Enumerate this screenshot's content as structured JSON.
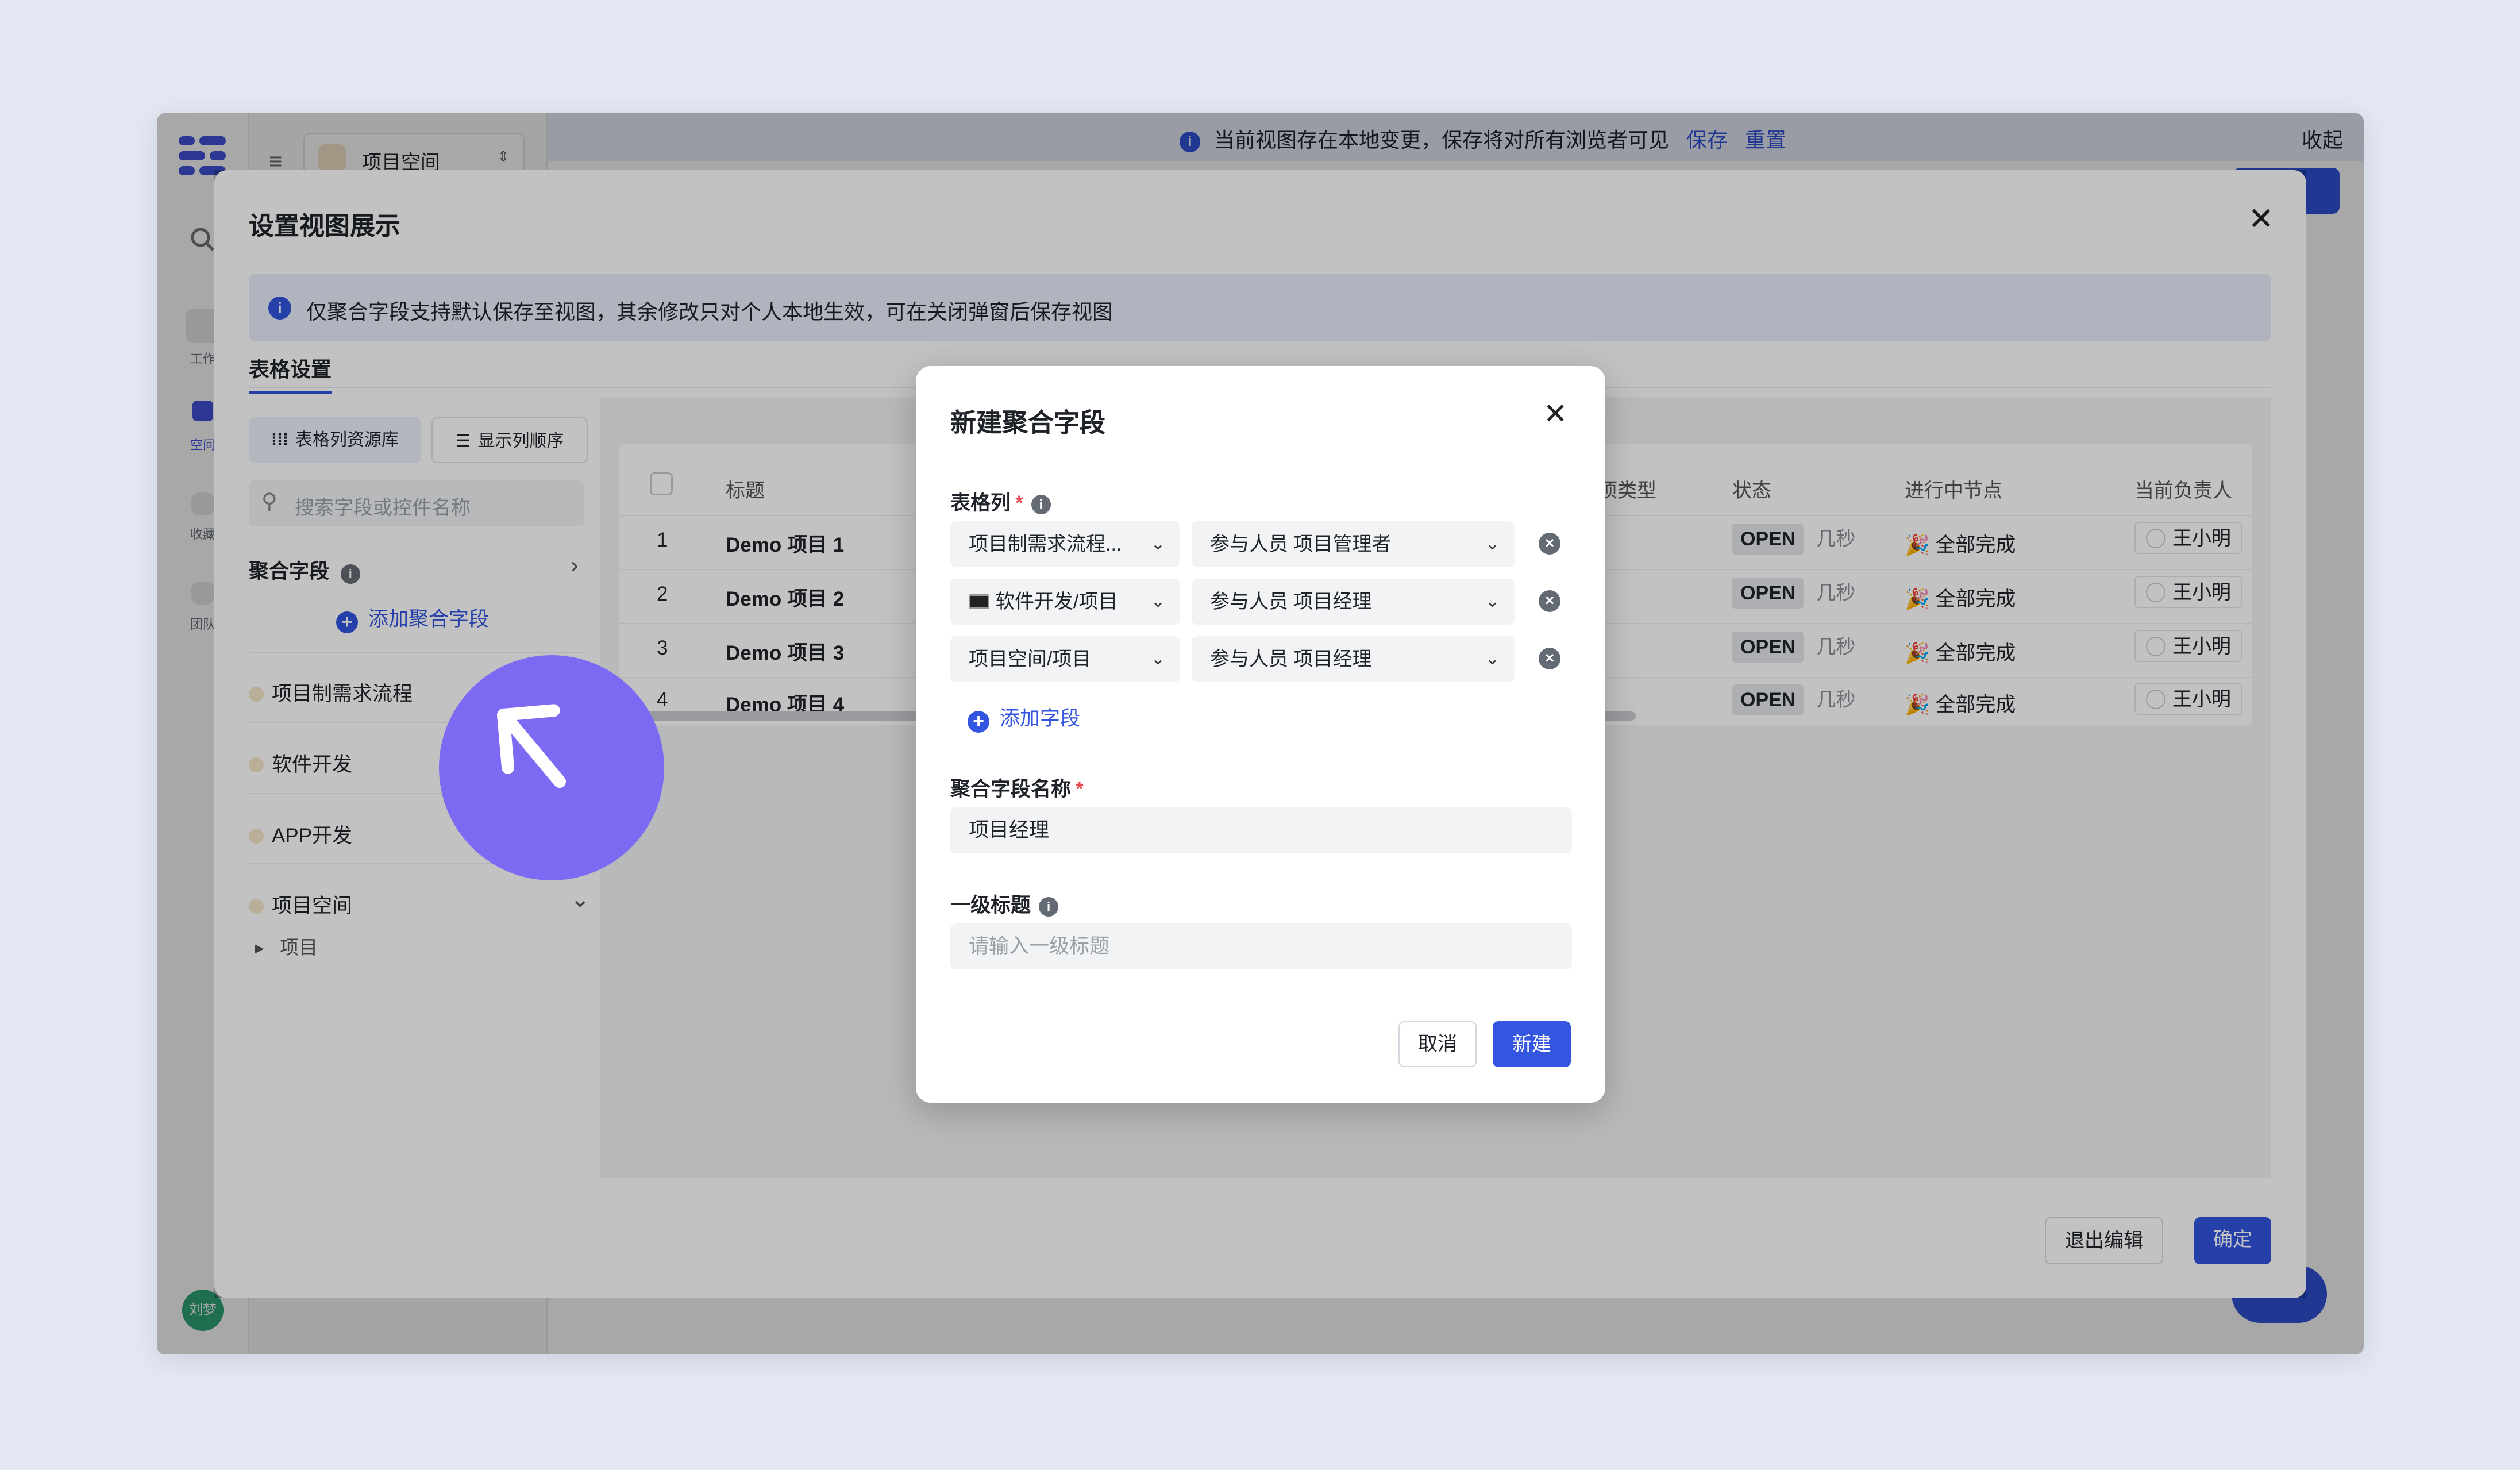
{
  "app": {
    "workspace_name": "项目空间",
    "rail_labels": [
      "工作",
      "空间",
      "收藏",
      "团队"
    ],
    "user_avatar": "刘梦",
    "notice_text": "当前视图存在本地变更，保存将对所有浏览者可见",
    "notice_save": "保存",
    "notice_reset": "重置",
    "collapse": "收起",
    "accent_color": "#3355e0"
  },
  "outer_dialog": {
    "title": "设置视图展示",
    "banner": "仅聚合字段支持默认保存至视图，其余修改只对个人本地生效，可在关闭弹窗后保存视图",
    "tab": "表格设置",
    "chip_library": "表格列资源库",
    "chip_order": "显示列顺序",
    "search_placeholder": "搜索字段或控件名称",
    "agg_section": "聚合字段",
    "add_agg": "添加聚合字段",
    "groups": [
      "项目制需求流程",
      "软件开发",
      "APP开发",
      "项目空间"
    ],
    "tree_item": "项目",
    "exit_button": "退出编辑",
    "ok_button": "确定"
  },
  "table": {
    "columns": [
      "标题",
      "项类型",
      "状态",
      "进行中节点",
      "当前负责人"
    ],
    "rows": [
      {
        "num": "1",
        "title": "Demo 项目 1",
        "status": "OPEN",
        "age": "几秒",
        "node": "全部完成",
        "owner": "王小明"
      },
      {
        "num": "2",
        "title": "Demo 项目 2",
        "status": "OPEN",
        "age": "几秒",
        "node": "全部完成",
        "owner": "王小明"
      },
      {
        "num": "3",
        "title": "Demo 项目 3",
        "status": "OPEN",
        "age": "几秒",
        "node": "全部完成",
        "owner": "王小明"
      },
      {
        "num": "4",
        "title": "Demo 项目 4",
        "status": "OPEN",
        "age": "几秒",
        "node": "全部完成",
        "owner": "王小明"
      }
    ]
  },
  "modal": {
    "title": "新建聚合字段",
    "columns_label": "表格列",
    "rows": [
      {
        "source": "项目制需求流程...",
        "field": "参与人员 项目管理者"
      },
      {
        "source": "软件开发/项目",
        "field": "参与人员 项目经理"
      },
      {
        "source": "项目空间/项目",
        "field": "参与人员 项目经理"
      }
    ],
    "add_field": "添加字段",
    "name_label": "聚合字段名称",
    "name_value": "项目经理",
    "heading_label": "一级标题",
    "heading_placeholder": "请输入一级标题",
    "cancel": "取消",
    "create": "新建"
  }
}
